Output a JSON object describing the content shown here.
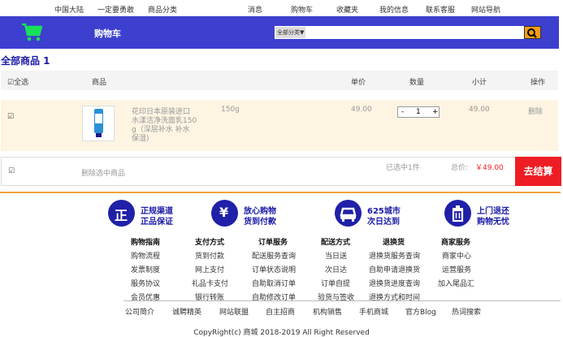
{
  "topnav": {
    "items": [
      "中国大陆",
      "一定要勇敢",
      "商品分类",
      "消息",
      "购物车",
      "收藏夹",
      "我的信息",
      "联系客服",
      "网站导航"
    ]
  },
  "header": {
    "title": "购物车",
    "search_select": "全部分类▼",
    "search_placeholder": ""
  },
  "section_title": "全部商品 1",
  "table_header": {
    "select_all": "☑全选",
    "product": "商品",
    "price": "单价",
    "quantity": "数量",
    "subtotal": "小计",
    "action": "操作"
  },
  "cart_items": [
    {
      "checkbox": "☑",
      "name_lines": [
        "花印日本原装进口",
        "水漾洁净洗面乳150",
        "g（深层补水 补水",
        "保湿)"
      ],
      "spec": "150g",
      "price": "49.00",
      "qty_minus": "-",
      "qty": "1",
      "qty_plus": "+",
      "subtotal": "49.00",
      "delete": "删除"
    }
  ],
  "bottom": {
    "checkbox": "☑",
    "delete_selected": "删除选中商品",
    "selected": "已选中1件",
    "total_label": "总价:",
    "total_value": "￥49.00",
    "checkout": "去结算"
  },
  "features": [
    {
      "icon": "正",
      "line1": "正规渠道",
      "line2": "正品保证"
    },
    {
      "icon": "¥",
      "line1": "放心购物",
      "line2": "货到付款"
    },
    {
      "icon": "car-icon",
      "line1": "625城市",
      "line2": "次日达到"
    },
    {
      "icon": "trash-icon",
      "line1": "上门退还",
      "line2": "购物无忧"
    }
  ],
  "help_columns": [
    {
      "heading": "购物指南",
      "items": [
        "购物流程",
        "发票制度",
        "服务协议",
        "会员优惠"
      ]
    },
    {
      "heading": "支付方式",
      "items": [
        "货到付款",
        "网上支付",
        "礼品卡支付",
        "银行转账"
      ]
    },
    {
      "heading": "订单服务",
      "items": [
        "配送服务查询",
        "订单状态说明",
        "自助取消订单",
        "自助修改订单"
      ]
    },
    {
      "heading": "配送方式",
      "items": [
        "当日送",
        "次日达",
        "订单自提",
        "验货与签收"
      ]
    },
    {
      "heading": "退换货",
      "items": [
        "退换货服务查询",
        "自助申请退换货",
        "退换货进度查询",
        "退换方式和时间"
      ]
    },
    {
      "heading": "商家服务",
      "items": [
        "商家中心",
        "运营服务",
        "加入尾品汇"
      ]
    }
  ],
  "footer_links": [
    "公司简介",
    "诚聘精英",
    "网站联盟",
    "自主招商",
    "机构销售",
    "手机商城",
    "官方Blog",
    "热词搜索"
  ],
  "copyright": "CopyRight(c) 商城 2018-2019 All Right Reserved",
  "colors": {
    "brand_blue": "#3d3fcf",
    "checkout_red": "#ee1d23",
    "price_red": "#ee1d23",
    "accent_orange": "#f3a13a"
  }
}
